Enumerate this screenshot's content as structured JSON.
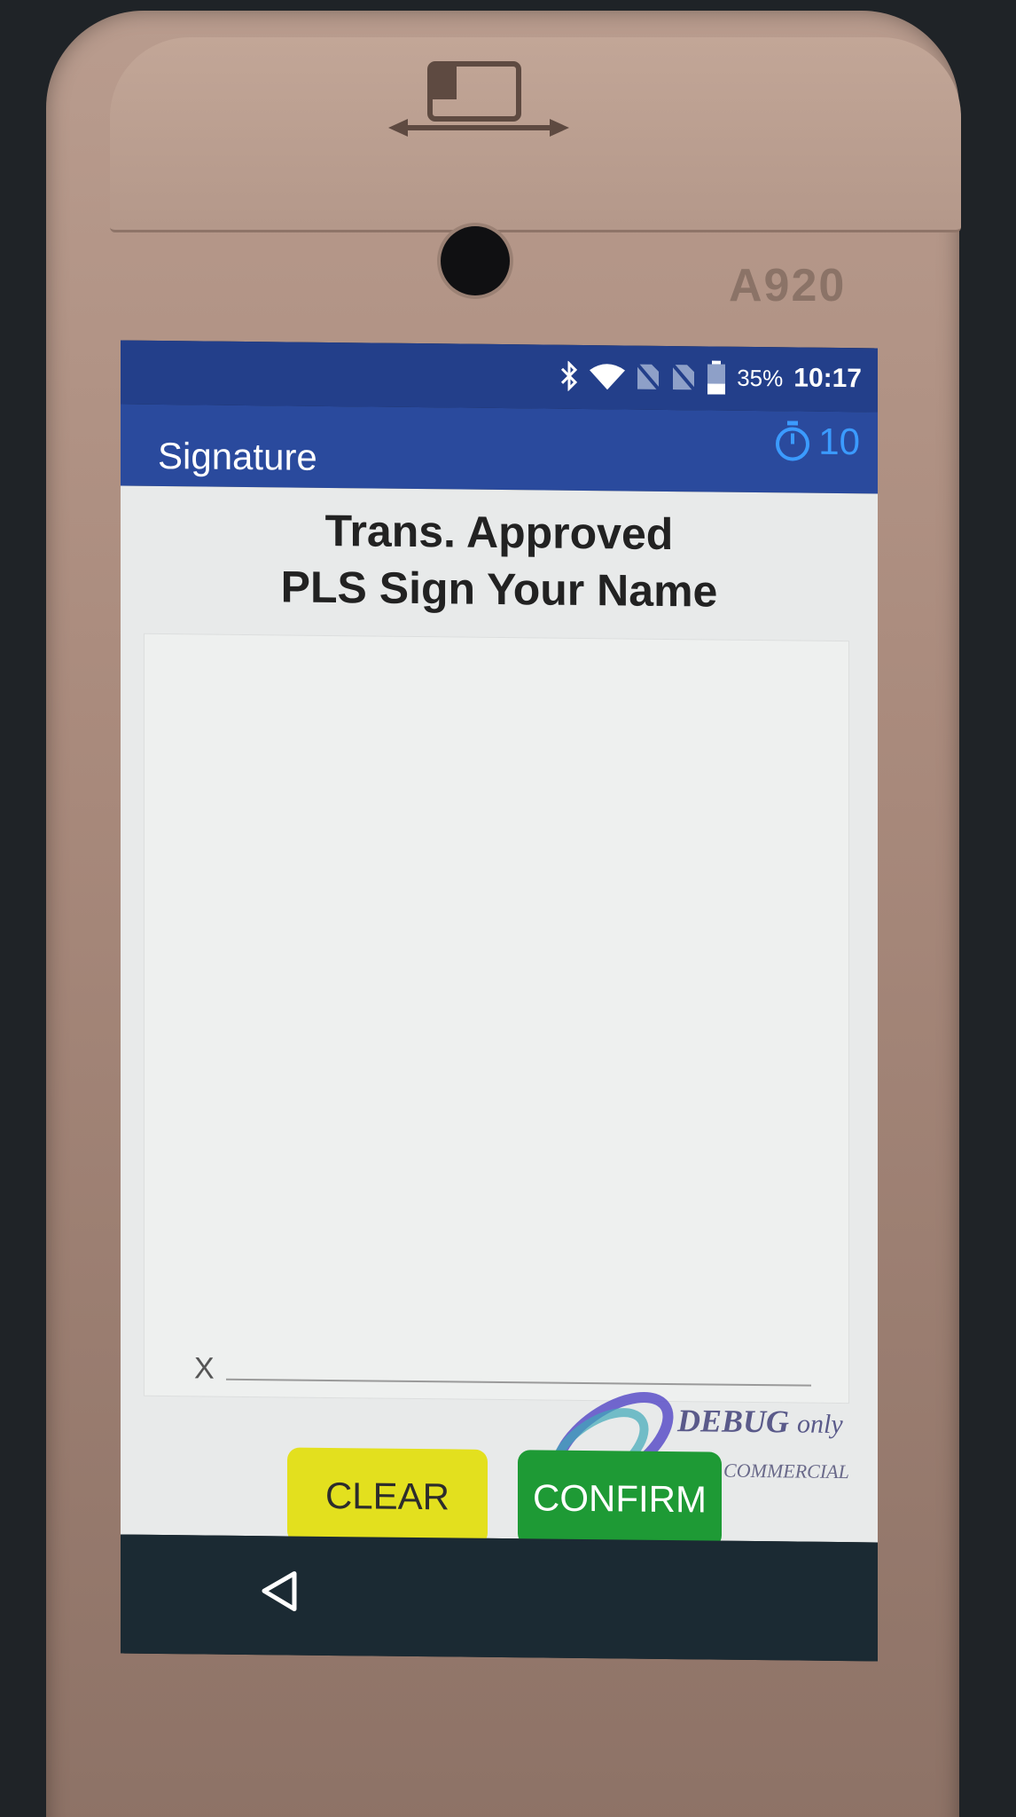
{
  "device": {
    "model": "A920"
  },
  "statusbar": {
    "icons": [
      "bluetooth-icon",
      "wifi-icon",
      "no-sim-icon",
      "no-sim-icon",
      "battery-icon"
    ],
    "battery": "35%",
    "time": "10:17"
  },
  "appbar": {
    "title": "Signature",
    "timer_icon": "stopwatch-icon",
    "timer_value": "10"
  },
  "content": {
    "heading_line1": "Trans. Approved",
    "heading_line2": "PLS Sign Your Name",
    "signature_marker": "X"
  },
  "watermark": {
    "debug": "DEBUG",
    "only": "only",
    "commercial": "r COMMERCIAL"
  },
  "buttons": {
    "clear": "CLEAR",
    "confirm": "CONFIRM"
  },
  "navbar": {
    "back_icon": "back-triangle-icon"
  },
  "colors": {
    "statusbar": "#233f8a",
    "appbar": "#2a4a9d",
    "timer": "#3b9bff",
    "clear_button": "#e3e01e",
    "confirm_button": "#1e9a35"
  }
}
